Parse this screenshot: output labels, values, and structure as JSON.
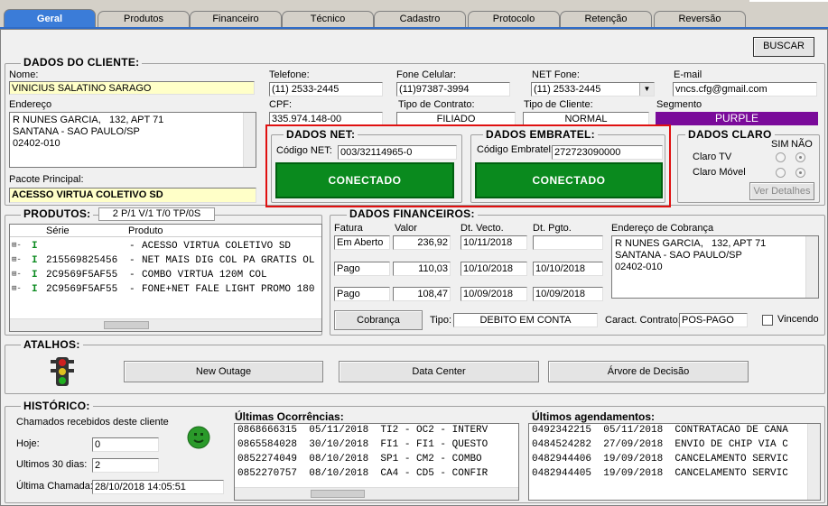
{
  "tabs": [
    "Geral",
    "Produtos",
    "Financeiro",
    "Técnico",
    "Cadastro",
    "Protocolo",
    "Retenção",
    "Reversão"
  ],
  "buscar": "BUSCAR",
  "cliente": {
    "title": "DADOS DO CLIENTE:",
    "nome_label": "Nome:",
    "nome": "VINICIUS SALATINO SARAGO",
    "endereco_label": "Endereço",
    "endereco": "R NUNES GARCIA,   132, APT 71\nSANTANA - SAO PAULO/SP\n02402-010",
    "pacote_label": "Pacote Principal:",
    "pacote": "ACESSO VIRTUA COLETIVO SD",
    "telefone_label": "Telefone:",
    "telefone": "(11) 2533-2445",
    "celular_label": "Fone Celular:",
    "celular": "(11)97387-3994",
    "netfone_label": "NET Fone:",
    "netfone": "(11) 2533-2445",
    "email_label": "E-mail",
    "email": "vncs.cfg@gmail.com",
    "cpf_label": "CPF:",
    "cpf": "335.974.148-00",
    "contrato_label": "Tipo de Contrato:",
    "contrato": "FILIADO",
    "tipocliente_label": "Tipo de Cliente:",
    "tipocliente": "NORMAL",
    "segmento_label": "Segmento",
    "segmento": "PURPLE"
  },
  "net": {
    "title": "DADOS NET:",
    "codigo_label": "Código NET:",
    "codigo": "003/32114965-0",
    "status": "CONECTADO"
  },
  "embratel": {
    "title": "DADOS EMBRATEL:",
    "codigo_label": "Código Embratel:",
    "codigo": "272723090000",
    "status": "CONECTADO"
  },
  "claro": {
    "title": "DADOS CLARO",
    "sim": "SIM",
    "nao": "NÃO",
    "tv": "Claro TV",
    "movel": "Claro Móvel",
    "detalhes": "Ver Detalhes"
  },
  "produtos": {
    "title": "PRODUTOS:",
    "summary": "2 P/1 V/1 T/0 TP/0S",
    "col_serie": "Série",
    "col_produto": "Produto",
    "rows": [
      {
        "serie": "",
        "produto": "ACESSO VIRTUA COLETIVO SD"
      },
      {
        "serie": "215569825456",
        "produto": "NET MAIS DIG COL PA GRATIS OL"
      },
      {
        "serie": "2C9569F5AF55",
        "produto": "COMBO VIRTUA 120M COL"
      },
      {
        "serie": "2C9569F5AF55",
        "produto": "FONE+NET FALE LIGHT PROMO 180"
      }
    ]
  },
  "financeiro": {
    "title": "DADOS FINANCEIROS:",
    "col_fatura": "Fatura",
    "col_valor": "Valor",
    "col_vecto": "Dt. Vecto.",
    "col_pgto": "Dt. Pgto.",
    "col_end": "Endereço de Cobrança",
    "rows": [
      {
        "fatura": "Em Aberto",
        "valor": "236,92",
        "vecto": "10/11/2018",
        "pgto": ""
      },
      {
        "fatura": "Pago",
        "valor": "110,03",
        "vecto": "10/10/2018",
        "pgto": "10/10/2018"
      },
      {
        "fatura": "Pago",
        "valor": "108,47",
        "vecto": "10/09/2018",
        "pgto": "10/09/2018"
      }
    ],
    "endereco": "R NUNES GARCIA,   132, APT 71\nSANTANA - SAO PAULO/SP\n02402-010",
    "cobranca_btn": "Cobrança",
    "tipo_label": "Tipo:",
    "tipo": "DEBITO EM CONTA",
    "caract_label": "Caract. Contrato:",
    "caract": "POS-PAGO",
    "vincendo": "Vincendo"
  },
  "atalhos": {
    "title": "ATALHOS:",
    "b1": "New Outage",
    "b2": "Data Center",
    "b3": "Árvore de Decisão"
  },
  "historico": {
    "title": "HISTÓRICO:",
    "recebidos": "Chamados recebidos deste cliente",
    "hoje_label": "Hoje:",
    "hoje": "0",
    "ultimos30_label": "Ultimos 30 dias:",
    "ultimos30": "2",
    "ultima_label": "Última Chamada:",
    "ultima": "28/10/2018 14:05:51"
  },
  "ocorrencias": {
    "title": "Últimas Ocorrências:",
    "rows": [
      "0868666315  05/11/2018  TI2 - OC2 - INTERV",
      "0865584028  30/10/2018  FI1 - FI1 - QUESTO",
      "0852274049  08/10/2018  SP1 - CM2 - COMBO",
      "0852270757  08/10/2018  CA4 - CD5 - CONFIR"
    ]
  },
  "agendamentos": {
    "title": "Últimos agendamentos:",
    "rows": [
      "0492342215  05/11/2018  CONTRATACAO DE CANA",
      "0484524282  27/09/2018  ENVIO DE CHIP VIA C",
      "0482944406  19/09/2018  CANCELAMENTO SERVIC",
      "0482944405  19/09/2018  CANCELAMENTO SERVIC"
    ]
  },
  "colors": {
    "tab_active": "#3b7cd8",
    "connected": "#0a8a1e",
    "purple": "#7a0a9a",
    "highlight": "#e01010",
    "yellow_field": "#ffffc8"
  }
}
